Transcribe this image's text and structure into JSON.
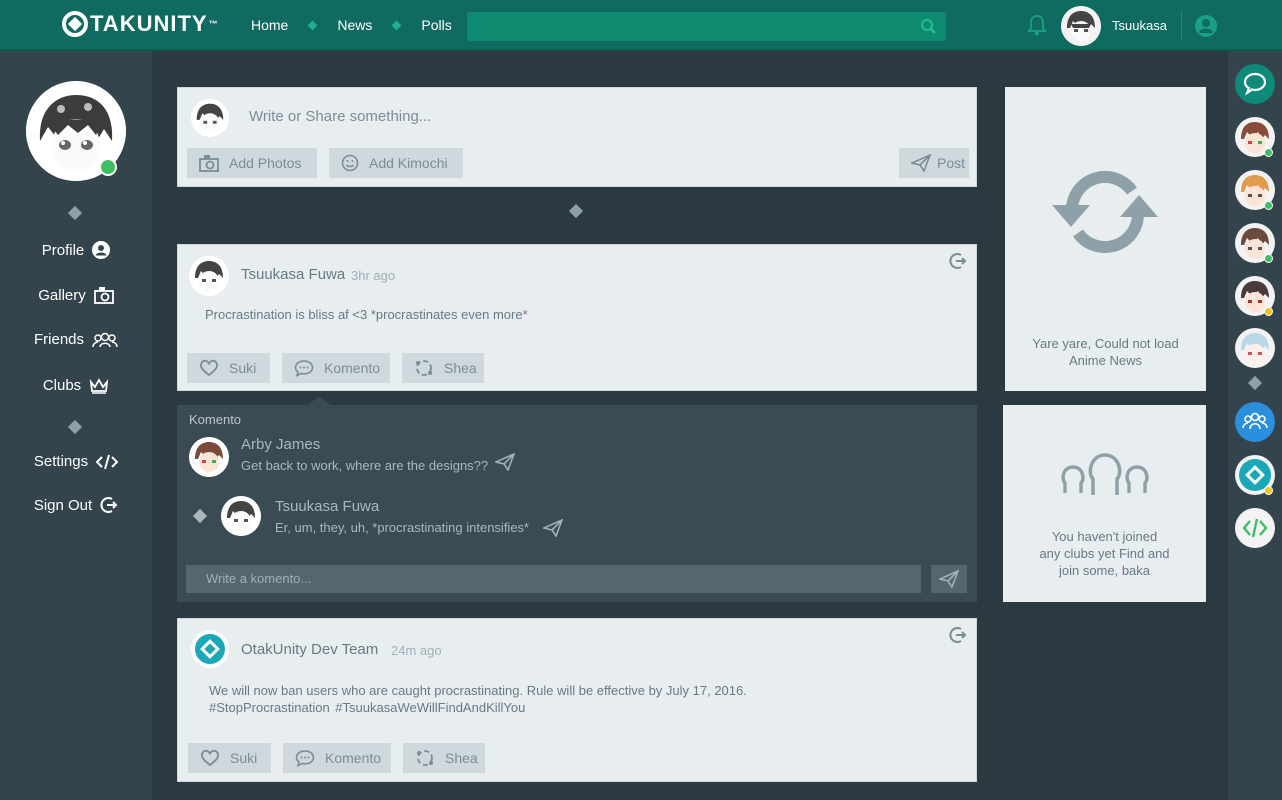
{
  "header": {
    "logo": "TAKUNITY",
    "logo_tm": "™",
    "nav": [
      "Home",
      "News",
      "Polls"
    ],
    "username": "Tsuukasa"
  },
  "sidebar": {
    "items": [
      {
        "label": "Profile",
        "icon": "user-circle-icon"
      },
      {
        "label": "Gallery",
        "icon": "camera-icon"
      },
      {
        "label": "Friends",
        "icon": "group-icon"
      },
      {
        "label": "Clubs",
        "icon": "crown-icon"
      },
      {
        "label": "Settings",
        "icon": "code-icon"
      },
      {
        "label": "Sign Out",
        "icon": "sign-out-icon"
      }
    ]
  },
  "composer": {
    "placeholder": "Write or Share something...",
    "add_photos": "Add Photos",
    "add_kimochi": "Add Kimochi",
    "post": "Post"
  },
  "posts": [
    {
      "author": "Tsuukasa Fuwa",
      "time": "3hr ago",
      "text": "Procrastination is bliss af <3 *procrastinates even more*",
      "actions": [
        "Suki",
        "Komento",
        "Shea"
      ]
    },
    {
      "author": "OtakUnity Dev Team",
      "time": "24m ago",
      "text": "We will now ban users who are caught procrastinating. Rule will be effective by July 17, 2016.",
      "tags": "#StopProcrastination  #TsuukasaWeWillFindAndKillYou",
      "actions": [
        "Suki",
        "Komento",
        "Shea"
      ]
    }
  ],
  "comments": {
    "label": "Komento",
    "items": [
      {
        "author": "Arby James",
        "text": "Get back to work, where are the designs??"
      },
      {
        "author": "Tsuukasa Fuwa",
        "text": "Er, um, they, uh, *procrastinating intensifies*"
      }
    ],
    "input_placeholder": "Write a komento..."
  },
  "news_widget": {
    "line1": "Yare yare, Could not load",
    "line2": "Anime News"
  },
  "clubs_widget": {
    "line1": "You haven't joined",
    "line2": "any clubs yet Find and",
    "line3": "join some, baka"
  },
  "colors": {
    "header": "#0f6b5f",
    "accent": "#1aa184",
    "online": "#3fbf62",
    "away": "#f0c419",
    "active_blue": "#2b8fdd"
  }
}
